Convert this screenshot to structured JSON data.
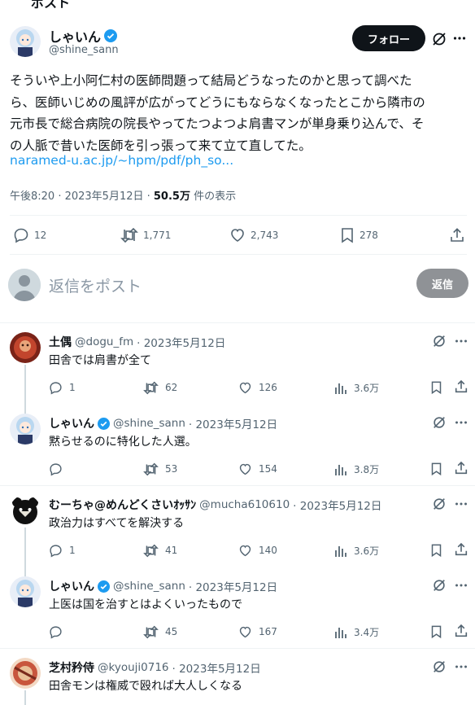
{
  "tweet": {
    "author_name": "しゃいん",
    "author_handle": "@shine_sann",
    "follow_label": "フォロー",
    "body_lines": [
      "そういや上小阿仁村の医師問題って結局どうなったのかと思って調べた",
      "ら、医師いじめの風評が広がってどうにもならなくなったとこから隣市の",
      "元市長で総合病院の院長やってたつよつよ肩書マンが単身乗り込んで、そ",
      "の人脈で昔いた医師を引っ張って来て立て直してた。"
    ],
    "link": "naramed-u.ac.jp/~hpm/pdf/ph_so...",
    "timestamp": "午後8:20 · 2023年5月12日 · ",
    "views": "50.5万",
    "views_label": " 件の表示",
    "replies": "12",
    "retweets": "1,771",
    "likes": "2,743",
    "bookmarks": "278"
  },
  "compose": {
    "placeholder": "返信をポスト",
    "reply_label": "返信"
  },
  "replies": [
    {
      "name": "土偶",
      "handle": "@dogu_fm",
      "date": "· 2023年5月12日",
      "text": "田舎では肩書が全て",
      "verified": false,
      "replies": "1",
      "retweets": "62",
      "likes": "126",
      "views": "3.6万"
    },
    {
      "name": "しゃいん",
      "handle": "@shine_sann",
      "date": "· 2023年5月12日",
      "text": "黙らせるのに特化した人選。",
      "verified": true,
      "replies": "",
      "retweets": "53",
      "likes": "154",
      "views": "3.8万"
    },
    {
      "name": "むーちゃ@めんどくさいｵｯｻﾝ",
      "handle": "@mucha610610",
      "date": "· 2023年5月12日",
      "text": "政治力はすべてを解決する",
      "verified": false,
      "replies": "1",
      "retweets": "41",
      "likes": "140",
      "views": "3.6万"
    },
    {
      "name": "しゃいん",
      "handle": "@shine_sann",
      "date": "· 2023年5月12日",
      "text": "上医は国を治すとはよくいったもので",
      "verified": true,
      "replies": "",
      "retweets": "45",
      "likes": "167",
      "views": "3.4万"
    },
    {
      "name": "芝村矜侍",
      "handle": "@kyouji0716",
      "date": "· 2023年5月12日",
      "text": "田舎モンは権威で殴れば大人しくなる",
      "verified": false
    }
  ],
  "colors": {
    "accent": "#1d9bf0",
    "text": "#0f1419",
    "muted": "#536471",
    "divider": "#eff3f4"
  }
}
